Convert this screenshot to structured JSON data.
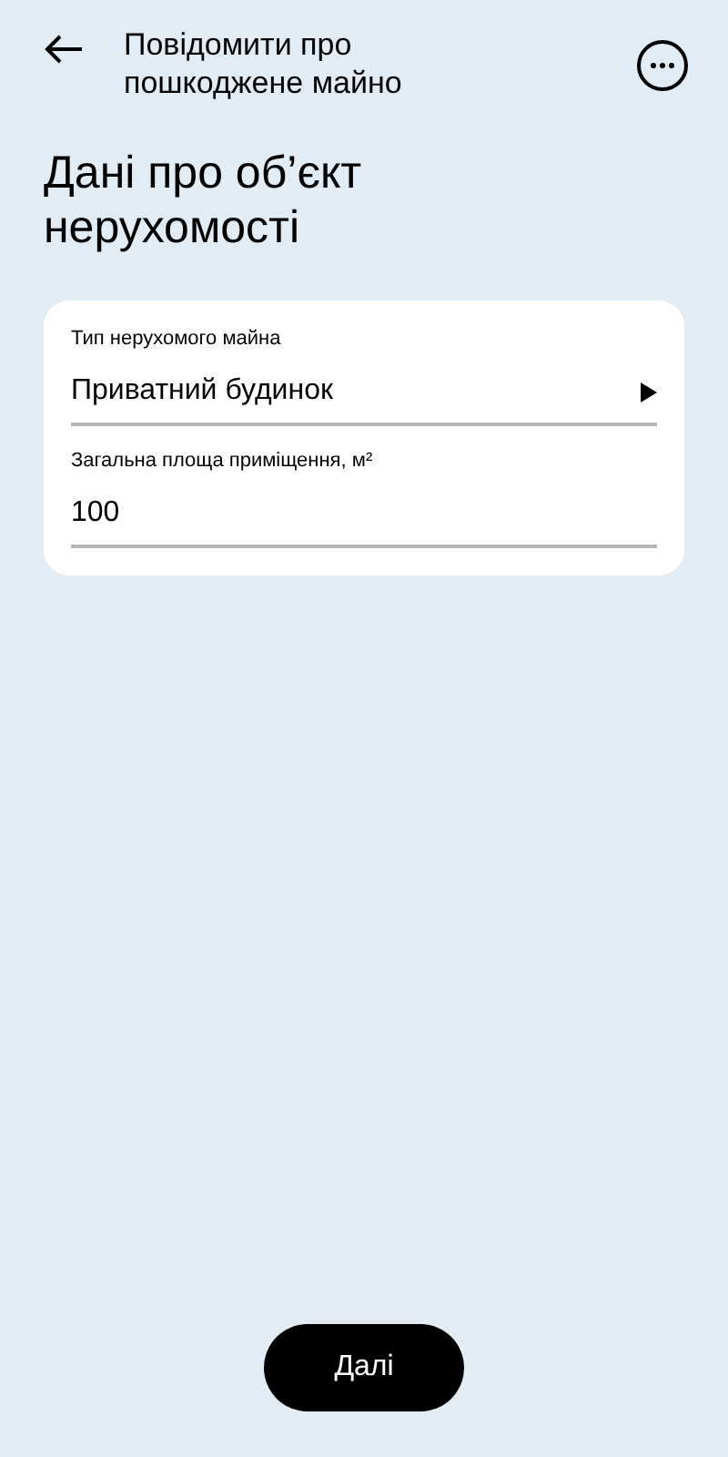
{
  "header": {
    "title": "Повідомити про пошкоджене майно"
  },
  "heading": "Дані про об’єкт нерухомості",
  "fields": [
    {
      "kind": "select",
      "label": "Тип нерухомого майна",
      "value": "Приватний будинок"
    },
    {
      "kind": "input",
      "label": "Загальна площа приміщення, м²",
      "value": "100"
    }
  ],
  "next_button": "Далі"
}
